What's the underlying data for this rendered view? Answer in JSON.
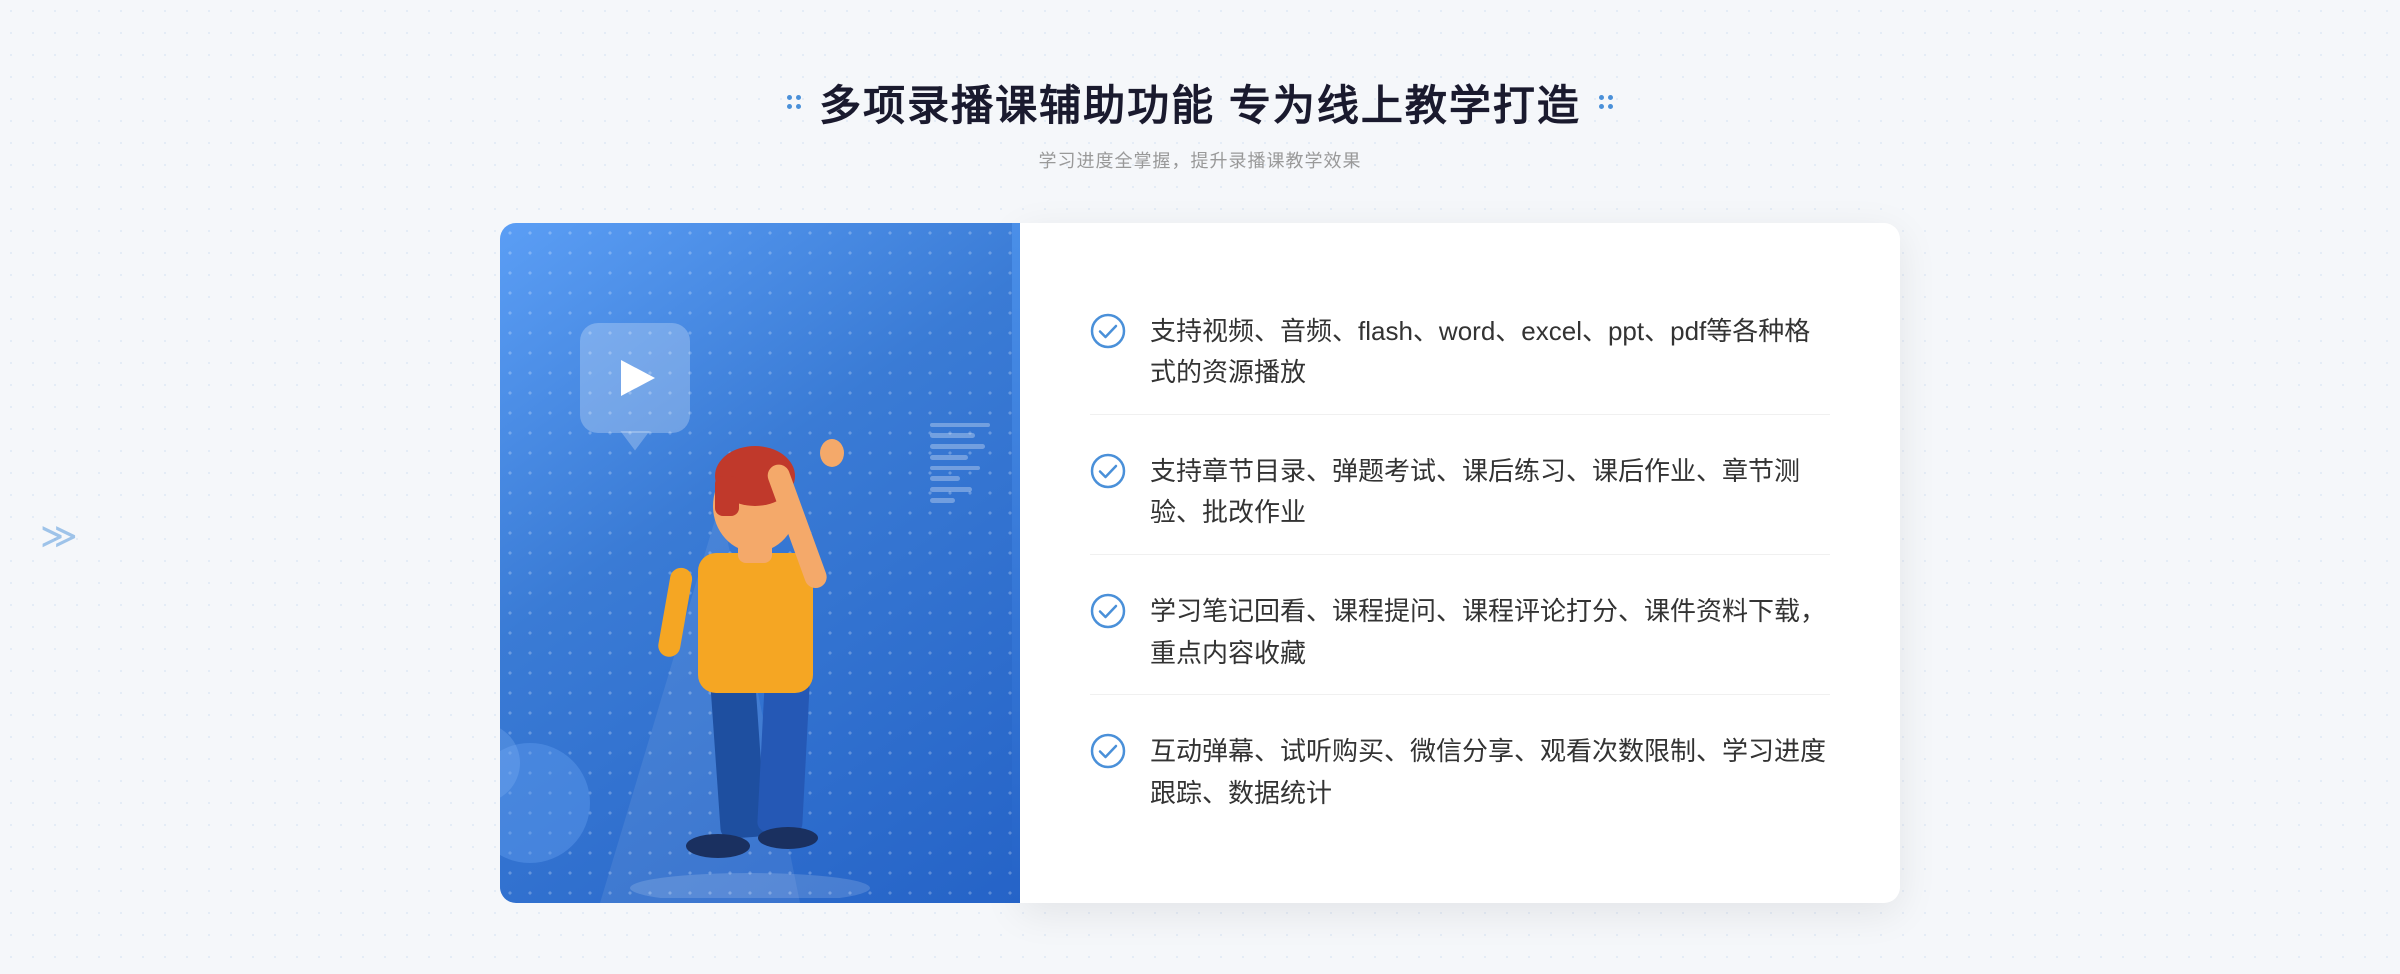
{
  "header": {
    "title": "多项录播课辅助功能 专为线上教学打造",
    "subtitle": "学习进度全掌握，提升录播课教学效果"
  },
  "features": [
    {
      "id": 1,
      "text": "支持视频、音频、flash、word、excel、ppt、pdf等各种格式的资源播放"
    },
    {
      "id": 2,
      "text": "支持章节目录、弹题考试、课后练习、课后作业、章节测验、批改作业"
    },
    {
      "id": 3,
      "text": "学习笔记回看、课程提问、课程评论打分、课件资料下载，重点内容收藏"
    },
    {
      "id": 4,
      "text": "互动弹幕、试听购买、微信分享、观看次数限制、学习进度跟踪、数据统计"
    }
  ],
  "icons": {
    "check": "check-circle-icon",
    "dots_left": "decorative-dots-left",
    "dots_right": "decorative-dots-right",
    "arrows": "decorative-double-arrows"
  },
  "colors": {
    "primary_blue": "#3a7bd5",
    "light_blue": "#5b9ef5",
    "check_blue": "#4a90d9",
    "text_dark": "#333333",
    "text_light": "#999999",
    "title_color": "#1a1a2e"
  }
}
